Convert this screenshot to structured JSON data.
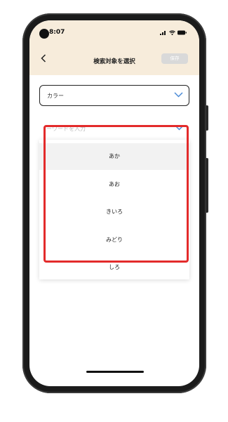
{
  "status": {
    "time": "8:07"
  },
  "header": {
    "title": "検索対象を選択",
    "back_icon": "chevron-left-icon",
    "save_label": "保存"
  },
  "category_select": {
    "value": "カラー",
    "icon": "chevron-down-icon"
  },
  "keyword": {
    "placeholder": "ーワードを入力",
    "icon": "chevron-down-icon"
  },
  "options": [
    {
      "label": "あか"
    },
    {
      "label": "あお"
    },
    {
      "label": "きいろ"
    },
    {
      "label": "みどり"
    },
    {
      "label": "しろ"
    }
  ],
  "colors": {
    "header_bg": "#f7ecdb",
    "accent": "#4a8ad6",
    "highlight": "#e32b2b"
  }
}
